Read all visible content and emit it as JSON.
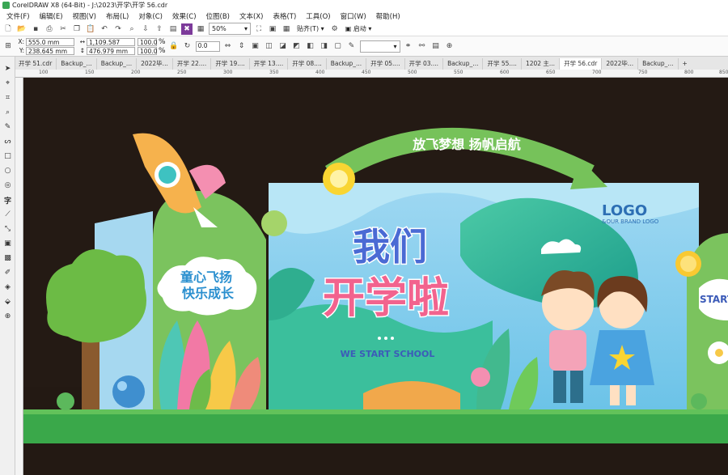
{
  "window": {
    "title": "CorelDRAW X8 (64-Bit) - J:\\2023\\开学\\开学 56.cdr"
  },
  "menu": [
    "文件(F)",
    "编辑(E)",
    "视图(V)",
    "布局(L)",
    "对象(C)",
    "效果(C)",
    "位图(B)",
    "文本(X)",
    "表格(T)",
    "工具(O)",
    "窗口(W)",
    "帮助(H)"
  ],
  "toolbar": {
    "zoom": "50%",
    "paste_label": "贴齐(T)",
    "launch_label": "启动"
  },
  "props": {
    "x": "555.0 mm",
    "y": "238.645 mm",
    "w": "1,109.587 mm",
    "h": "476.979 mm",
    "sx": "100.0",
    "sy": "100.0",
    "unit": "%",
    "rotate": "0.0"
  },
  "tabs": [
    "开学 51.cdr",
    "Backup_...",
    "Backup_...",
    "2022毕...",
    "开学 22....",
    "开学 19....",
    "开学 13....",
    "开学 08....",
    "Backup_...",
    "开学 05....",
    "开学 03....",
    "Backup_...",
    "开学 55....",
    "1202 主...",
    "开学 56.cdr",
    "2022毕...",
    "Backup_..."
  ],
  "active_tab": 14,
  "ruler": [
    "100",
    "150",
    "200",
    "250",
    "300",
    "350",
    "400",
    "450",
    "500",
    "550",
    "600",
    "650",
    "700",
    "750",
    "800",
    "850",
    "900",
    "950"
  ],
  "design": {
    "arch_text": "放飞梦想  扬帆启航",
    "panel_text_1": "童心飞扬",
    "panel_text_2": "快乐成长",
    "headline_1": "我们",
    "headline_2": "开学啦",
    "subtitle": "WE START SCHOOL",
    "logo": "LOGO",
    "logo_sub": "&OUR BRAND LOGO",
    "right_text": "START"
  }
}
